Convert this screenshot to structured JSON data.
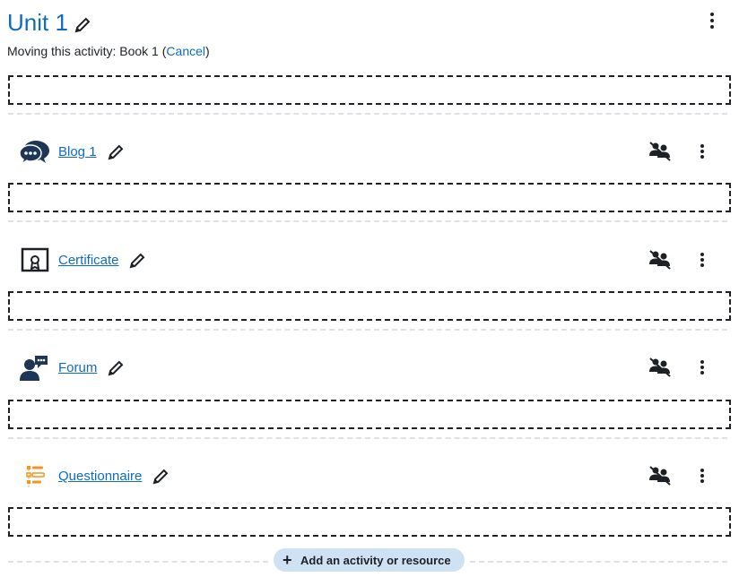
{
  "section": {
    "title": "Unit 1",
    "moving_text": "Moving this activity: Book 1 ",
    "cancel_label": "Cancel",
    "open_paren": "(",
    "close_paren": ")"
  },
  "activities": [
    {
      "name": "Blog 1",
      "icon": "blog-icon"
    },
    {
      "name": "Certificate",
      "icon": "certificate-icon"
    },
    {
      "name": "Forum",
      "icon": "forum-icon"
    },
    {
      "name": "Questionnaire",
      "icon": "questionnaire-icon"
    }
  ],
  "add_button": {
    "label": "Add an activity or resource",
    "icon": "plus-icon"
  },
  "colors": {
    "link": "#0f6cbf",
    "accent_orange": "#f7931e",
    "icon_dark": "#1d3557"
  }
}
